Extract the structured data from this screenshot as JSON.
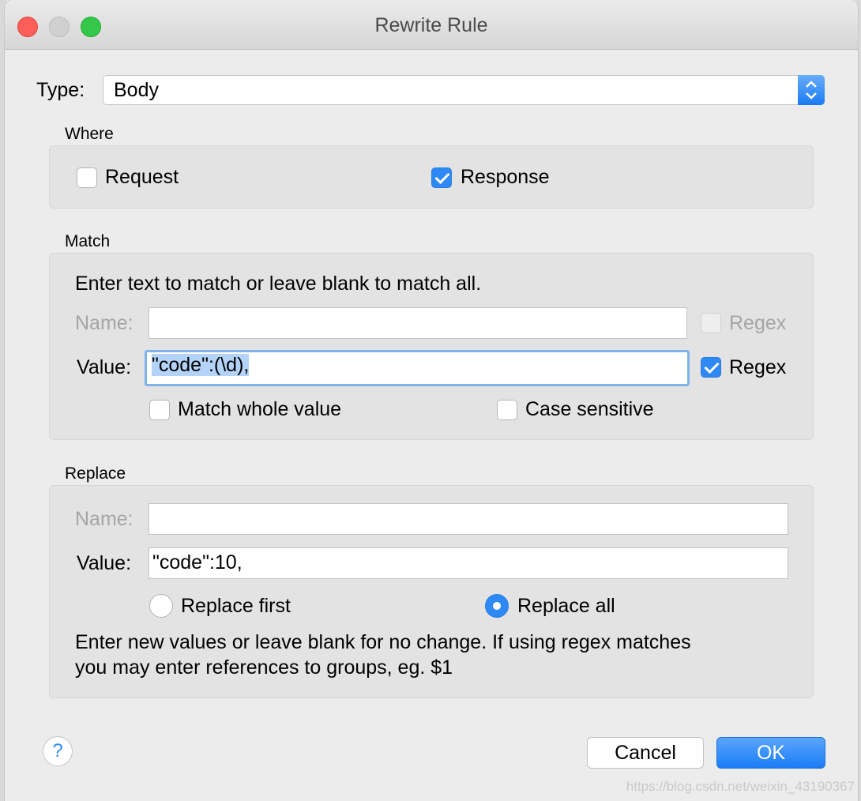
{
  "window": {
    "title": "Rewrite Rule"
  },
  "type_field": {
    "label": "Type:",
    "value": "Body"
  },
  "where": {
    "label": "Where",
    "request_label": "Request",
    "request_checked": false,
    "response_label": "Response",
    "response_checked": true
  },
  "match": {
    "label": "Match",
    "instructions": "Enter text to match or leave blank to match all.",
    "name_label": "Name:",
    "name_value": "",
    "name_regex_label": "Regex",
    "name_regex_checked": false,
    "value_label": "Value:",
    "value_value": "\"code\":(\\d),",
    "value_regex_label": "Regex",
    "value_regex_checked": true,
    "match_whole_label": "Match whole value",
    "match_whole_checked": false,
    "case_sensitive_label": "Case sensitive",
    "case_sensitive_checked": false
  },
  "replace": {
    "label": "Replace",
    "name_label": "Name:",
    "name_value": "",
    "value_label": "Value:",
    "value_value": "\"code\":10,",
    "replace_first_label": "Replace first",
    "replace_all_label": "Replace all",
    "selected_mode": "Replace all",
    "help_line1": "Enter new values or leave blank for no change. If using regex matches",
    "help_line2": "you may enter references to groups, eg. $1"
  },
  "buttons": {
    "help": "?",
    "cancel": "Cancel",
    "ok": "OK"
  },
  "watermark": "https://blog.csdn.net/weixin_43190367",
  "icons": {
    "select_arrows": "updown-chevron-icon",
    "checkmark": "checkmark-icon"
  },
  "colors": {
    "accent": "#2f89f5",
    "focus_ring": "#80b3ee",
    "close": "#fc5f57",
    "zoom": "#34c84a"
  }
}
